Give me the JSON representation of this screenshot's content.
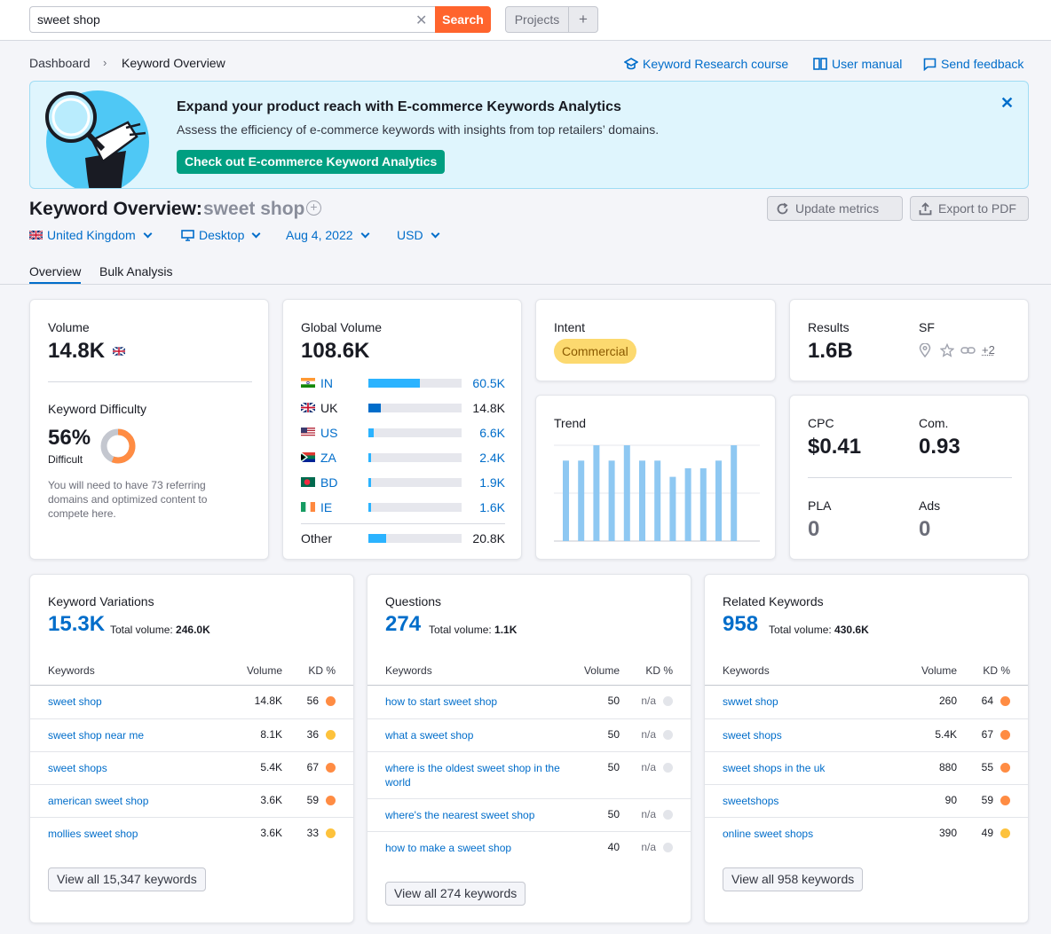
{
  "search": {
    "value": "sweet shop",
    "button": "Search"
  },
  "projects": {
    "label": "Projects",
    "add": "+"
  },
  "breadcrumb": {
    "home": "Dashboard",
    "current": "Keyword Overview"
  },
  "top_links": {
    "course": "Keyword Research course",
    "manual": "User manual",
    "feedback": "Send feedback"
  },
  "banner": {
    "title": "Expand your product reach with E-commerce Keywords Analytics",
    "text": "Assess the efficiency of e-commerce keywords with insights from top retailers’ domains.",
    "button": "Check out E-commerce Keyword Analytics"
  },
  "overview": {
    "title": "Keyword Overview:",
    "phrase": "sweet shop"
  },
  "actions": {
    "update": "Update metrics",
    "export": "Export to PDF"
  },
  "filters": {
    "country": "United Kingdom",
    "device": "Desktop",
    "date": "Aug 4, 2022",
    "currency": "USD"
  },
  "tabs": {
    "overview": "Overview",
    "bulk": "Bulk Analysis"
  },
  "volume": {
    "label": "Volume",
    "value": "14.8K",
    "kd_label": "Keyword Difficulty",
    "kd_value": "56%",
    "kd_level": "Difficult",
    "kd_percent": 56,
    "kd_text": "You will need to have 73 referring domains and optimized content to compete here."
  },
  "global_volume": {
    "label": "Global Volume",
    "value": "108.6K",
    "countries": [
      {
        "code": "IN",
        "value": "60.5K",
        "share": 0.55,
        "color": "#2bb3ff"
      },
      {
        "code": "UK",
        "value": "14.8K",
        "share": 0.13,
        "color": "#006dca"
      },
      {
        "code": "US",
        "value": "6.6K",
        "share": 0.06,
        "color": "#2bb3ff"
      },
      {
        "code": "ZA",
        "value": "2.4K",
        "share": 0.025,
        "color": "#2bb3ff"
      },
      {
        "code": "BD",
        "value": "1.9K",
        "share": 0.02,
        "color": "#2bb3ff"
      },
      {
        "code": "IE",
        "value": "1.6K",
        "share": 0.018,
        "color": "#2bb3ff"
      }
    ],
    "other": {
      "label": "Other",
      "value": "20.8K",
      "share": 0.19
    }
  },
  "intent": {
    "label": "Intent",
    "badge": "Commercial"
  },
  "results": {
    "label": "Results",
    "value": "1.6B",
    "sf_label": "SF",
    "sf_more": "+2"
  },
  "trend": {
    "label": "Trend"
  },
  "chart_data": {
    "type": "bar",
    "title": "Trend",
    "values": [
      0.84,
      0.84,
      1.0,
      0.84,
      1.0,
      0.84,
      0.84,
      0.67,
      0.76,
      0.76,
      0.84,
      1.0
    ]
  },
  "cpc": {
    "cpc_label": "CPC",
    "cpc_value": "$0.41",
    "com_label": "Com.",
    "com_value": "0.93",
    "pla_label": "PLA",
    "pla_value": "0",
    "ads_label": "Ads",
    "ads_value": "0"
  },
  "variations": {
    "label": "Keyword Variations",
    "count": "15.3K",
    "total_label": "Total volume:",
    "total": "246.0K",
    "headers": {
      "kw": "Keywords",
      "vol": "Volume",
      "kd": "KD %"
    },
    "rows": [
      {
        "kw": "sweet shop",
        "vol": "14.8K",
        "kd": "56",
        "color": "#ff8c43"
      },
      {
        "kw": "sweet shop near me",
        "vol": "8.1K",
        "kd": "36",
        "color": "#fdc23c"
      },
      {
        "kw": "sweet shops",
        "vol": "5.4K",
        "kd": "67",
        "color": "#ff8c43"
      },
      {
        "kw": "american sweet shop",
        "vol": "3.6K",
        "kd": "59",
        "color": "#ff8c43"
      },
      {
        "kw": "mollies sweet shop",
        "vol": "3.6K",
        "kd": "33",
        "color": "#fdc23c"
      }
    ],
    "view_all": "View all 15,347 keywords"
  },
  "questions": {
    "label": "Questions",
    "count": "274",
    "total_label": "Total volume:",
    "total": "1.1K",
    "headers": {
      "kw": "Keywords",
      "vol": "Volume",
      "kd": "KD %"
    },
    "rows": [
      {
        "kw": "how to start sweet shop",
        "vol": "50",
        "kd": "n/a"
      },
      {
        "kw": "what a sweet shop",
        "vol": "50",
        "kd": "n/a"
      },
      {
        "kw": "where is the oldest sweet shop in the world",
        "vol": "50",
        "kd": "n/a"
      },
      {
        "kw": "where's the nearest sweet shop",
        "vol": "50",
        "kd": "n/a"
      },
      {
        "kw": "how to make a sweet shop",
        "vol": "40",
        "kd": "n/a"
      }
    ],
    "view_all": "View all 274 keywords"
  },
  "related": {
    "label": "Related Keywords",
    "count": "958",
    "total_label": "Total volume:",
    "total": "430.6K",
    "headers": {
      "kw": "Keywords",
      "vol": "Volume",
      "kd": "KD %"
    },
    "rows": [
      {
        "kw": "swwet shop",
        "vol": "260",
        "kd": "64",
        "color": "#ff8c43"
      },
      {
        "kw": "sweet shops",
        "vol": "5.4K",
        "kd": "67",
        "color": "#ff8c43"
      },
      {
        "kw": "sweet shops in the uk",
        "vol": "880",
        "kd": "55",
        "color": "#ff8c43"
      },
      {
        "kw": "sweetshops",
        "vol": "90",
        "kd": "59",
        "color": "#ff8c43"
      },
      {
        "kw": "online sweet shops",
        "vol": "390",
        "kd": "49",
        "color": "#fdc23c"
      }
    ],
    "view_all": "View all 958 keywords"
  }
}
